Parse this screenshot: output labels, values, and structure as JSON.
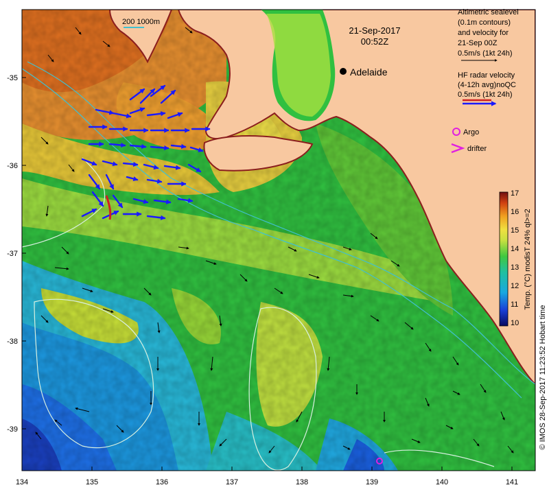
{
  "map": {
    "date": "21-Sep-2017",
    "time": "00:52Z",
    "scale_label": "200  1000m",
    "city_label": "Adelaide",
    "altimetric_legend": [
      "Altimetric sealevel",
      "(0.1m contours)",
      "and velocity for",
      "21-Sep 00Z",
      "0.5m/s (1kt 24h)"
    ],
    "hf_legend": [
      "HF radar velocity",
      "(4-12h avg)noQC",
      "0.5m/s (1kt 24h)"
    ],
    "argo_label": "Argo",
    "drifter_label": "drifter",
    "colorbar_label": "Temp. (°C) modisT 24% ql>=2",
    "colorbar_ticks": [
      "17",
      "16",
      "15",
      "14",
      "13",
      "12",
      "11",
      "10"
    ],
    "credit": "© IMOS 28-Sep-2017 11:23:52 Hobart time",
    "x_ticks": [
      "134",
      "135",
      "136",
      "137",
      "138",
      "139",
      "140",
      "141"
    ],
    "y_ticks": [
      "-35",
      "-36",
      "-37",
      "-38",
      "-39"
    ],
    "colors": {
      "land": "#f8c8a0",
      "coast": "#8b1e1e",
      "hf_arrow": "#1a1aff",
      "argo": "#e020e0",
      "contour": "#d8f0e0",
      "isobath": "#40c0d0"
    }
  }
}
